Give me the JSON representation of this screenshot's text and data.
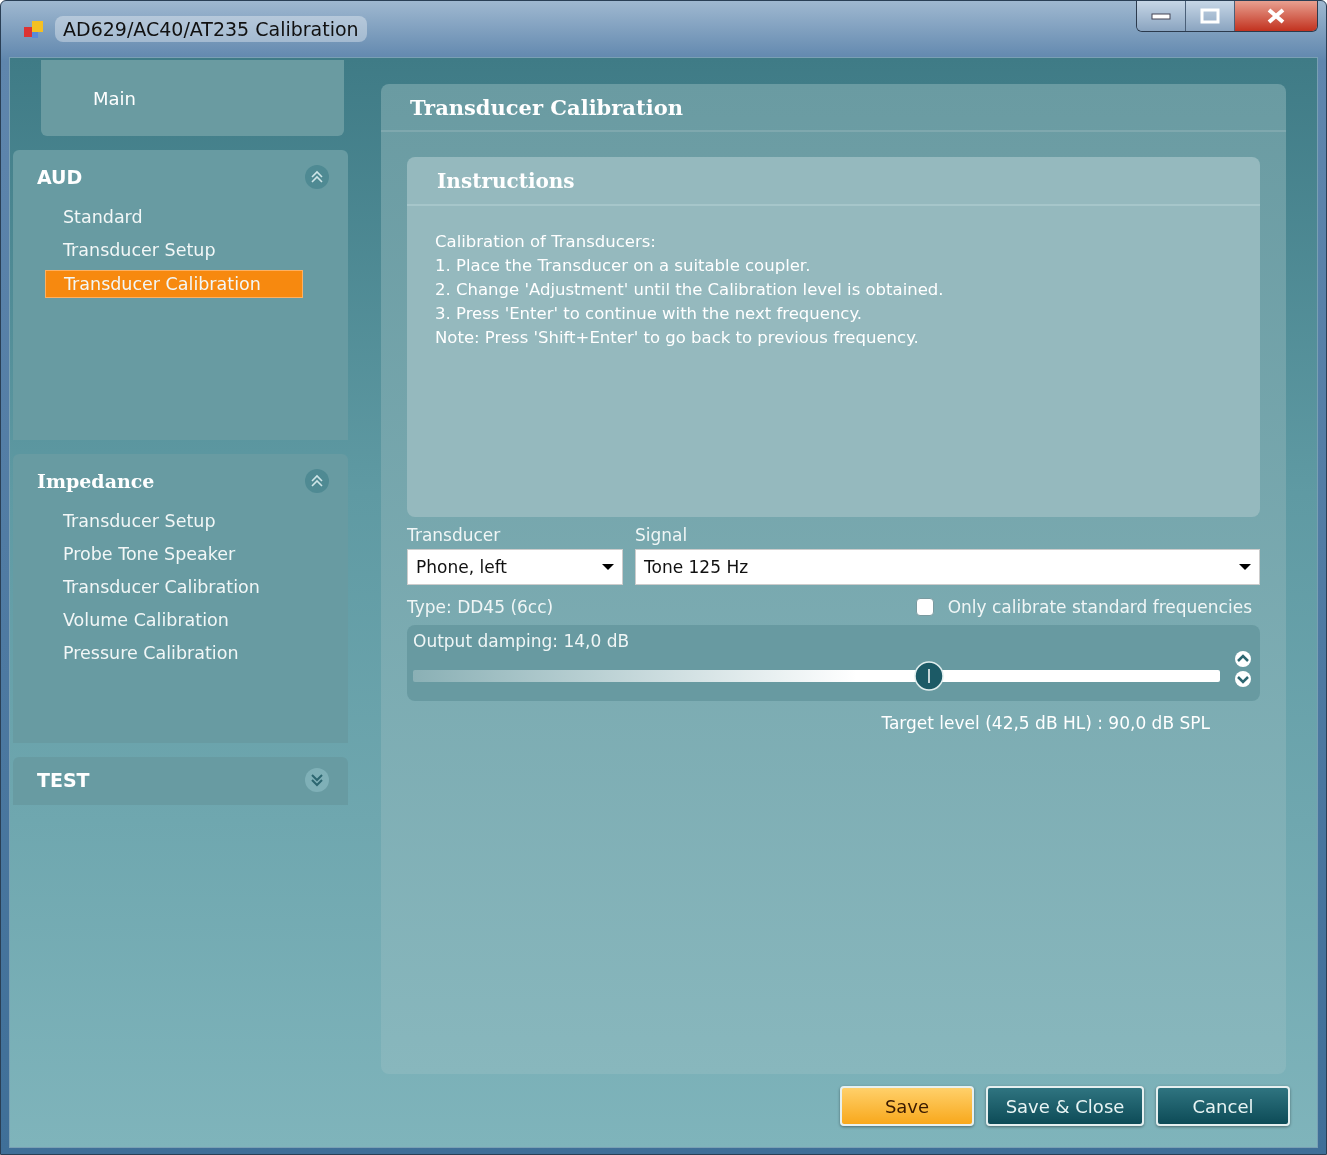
{
  "window": {
    "title": "AD629/AC40/AT235 Calibration"
  },
  "sidebar": {
    "main": {
      "label": "Main"
    },
    "sections": [
      {
        "title": "AUD",
        "expanded": true,
        "items": [
          {
            "label": "Standard",
            "selected": false
          },
          {
            "label": "Transducer Setup",
            "selected": false
          },
          {
            "label": "Transducer Calibration",
            "selected": true
          }
        ]
      },
      {
        "title": "Impedance",
        "expanded": true,
        "items": [
          {
            "label": "Transducer Setup",
            "selected": false
          },
          {
            "label": "Probe Tone Speaker",
            "selected": false
          },
          {
            "label": "Transducer Calibration",
            "selected": false
          },
          {
            "label": "Volume Calibration",
            "selected": false
          },
          {
            "label": "Pressure Calibration",
            "selected": false
          }
        ]
      },
      {
        "title": "TEST",
        "expanded": false
      }
    ]
  },
  "panel": {
    "title": "Transducer Calibration",
    "instructions": {
      "title": "Instructions",
      "lines": [
        "Calibration of Transducers:",
        "1. Place the Transducer on a suitable coupler.",
        "2. Change 'Adjustment' until the Calibration level is obtained.",
        "3. Press 'Enter' to continue with the next frequency.",
        "Note: Press 'Shift+Enter' to go back to previous frequency."
      ]
    },
    "transducer": {
      "label": "Transducer",
      "value": "Phone, left"
    },
    "signal": {
      "label": "Signal",
      "value": "Tone 125 Hz"
    },
    "type": "Type: DD45 (6cc)",
    "standard_only": {
      "label": "Only calibrate standard frequencies",
      "checked": false
    },
    "damping": {
      "label": "Output damping: 14,0 dB",
      "level": 0.64
    },
    "target": "Target level (42,5 dB HL) : 90,0 dB SPL"
  },
  "buttons": [
    {
      "label": "Save",
      "kind": "primary"
    },
    {
      "label": "Save & Close",
      "kind": "dark"
    },
    {
      "label": "Cancel",
      "kind": "dark"
    }
  ]
}
